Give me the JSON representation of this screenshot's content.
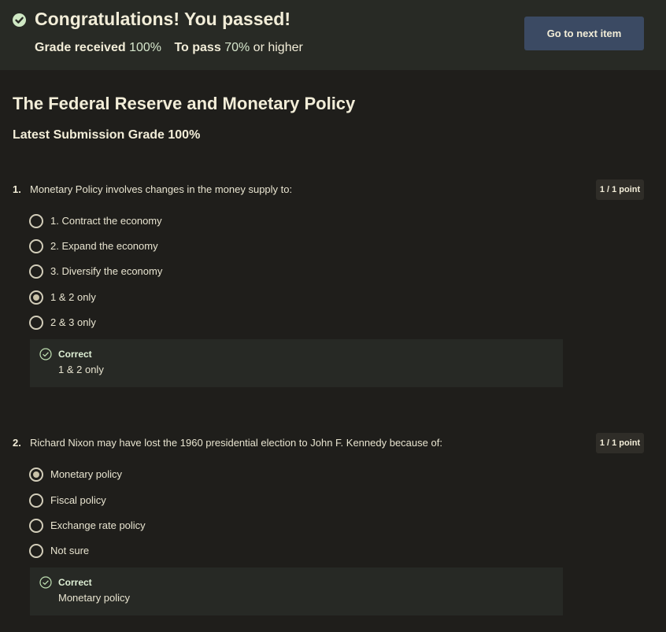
{
  "banner": {
    "title": "Congratulations! You passed!",
    "grade_label": "Grade received",
    "grade_value": "100%",
    "pass_label": "To pass",
    "pass_value": "70%",
    "pass_suffix": "or higher",
    "next_button": "Go to next item",
    "check_icon": "check-circle-icon"
  },
  "page": {
    "title": "The Federal Reserve and Monetary Policy",
    "subtitle": "Latest Submission Grade 100%"
  },
  "colors": {
    "background": "#1f1e1b",
    "banner": "#282a25",
    "button": "#3b4a63",
    "correct": "#dff0d6"
  },
  "questions": [
    {
      "number": "1.",
      "text": "Monetary Policy involves changes in the money supply to:",
      "points": "1 / 1 point",
      "options": [
        {
          "label": "1.   Contract the economy",
          "selected": false
        },
        {
          "label": "2.   Expand the economy",
          "selected": false
        },
        {
          "label": "3.   Diversify the economy",
          "selected": false
        },
        {
          "label": "1 & 2 only",
          "selected": true
        },
        {
          "label": "2 & 3 only",
          "selected": false
        }
      ],
      "feedback": {
        "title": "Correct",
        "answer": "1 & 2 only",
        "icon": "check-circle-outline-icon"
      }
    },
    {
      "number": "2.",
      "text": "Richard Nixon may have lost the 1960 presidential election to John F. Kennedy because of:",
      "points": "1 / 1 point",
      "options": [
        {
          "label": "Monetary policy",
          "selected": true
        },
        {
          "label": "Fiscal policy",
          "selected": false
        },
        {
          "label": "Exchange rate policy",
          "selected": false
        },
        {
          "label": "Not sure",
          "selected": false
        }
      ],
      "feedback": {
        "title": "Correct",
        "answer": "Monetary policy",
        "icon": "check-circle-outline-icon"
      }
    }
  ]
}
